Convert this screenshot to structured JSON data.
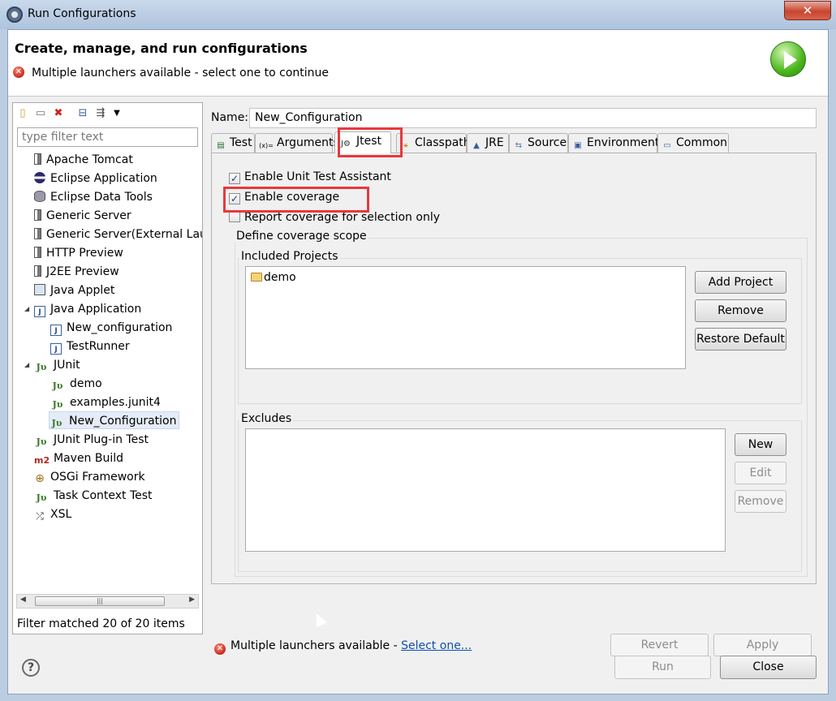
{
  "window": {
    "title": "Run Configurations",
    "close_label": "✕"
  },
  "banner": {
    "title": "Create, manage, and run configurations",
    "message": "Multiple launchers available - select one to continue"
  },
  "left": {
    "toolbar": [
      "new-config-icon",
      "duplicate-icon",
      "delete-icon",
      "collapse-all-icon",
      "filter-icon",
      "view-menu-icon"
    ],
    "filter": {
      "placeholder": "type filter text",
      "value": ""
    },
    "tree": [
      {
        "label": "Apache Tomcat",
        "icon": "server-icon"
      },
      {
        "label": "Eclipse Application",
        "icon": "eclipse-icon"
      },
      {
        "label": "Eclipse Data Tools",
        "icon": "database-icon"
      },
      {
        "label": "Generic Server",
        "icon": "server-icon"
      },
      {
        "label": "Generic Server(External Lau",
        "icon": "server-icon"
      },
      {
        "label": "HTTP Preview",
        "icon": "server-icon"
      },
      {
        "label": "J2EE Preview",
        "icon": "server-icon"
      },
      {
        "label": "Java Applet",
        "icon": "applet-icon"
      },
      {
        "label": "Java Application",
        "icon": "java-app-icon",
        "expanded": true
      },
      {
        "label": "New_configuration",
        "icon": "java-app-icon"
      },
      {
        "label": "TestRunner",
        "icon": "java-app-icon"
      },
      {
        "label": "JUnit",
        "icon": "junit-icon",
        "expanded": true
      },
      {
        "label": "demo",
        "icon": "junit-icon"
      },
      {
        "label": "examples.junit4",
        "icon": "junit-icon"
      },
      {
        "label": "New_Configuration",
        "icon": "junit-icon",
        "selected": true
      },
      {
        "label": "JUnit Plug-in Test",
        "icon": "junit-plugin-icon"
      },
      {
        "label": "Maven Build",
        "icon": "maven-icon"
      },
      {
        "label": "OSGi Framework",
        "icon": "osgi-icon"
      },
      {
        "label": "Task Context Test",
        "icon": "junit-icon"
      },
      {
        "label": "XSL",
        "icon": "xsl-icon"
      }
    ],
    "icon_glyphs": {
      "ju": "Jυ",
      "m2": "m2",
      "osgi": "⊕",
      "xsl": "⤮",
      "app": "J"
    },
    "filter_status": "Filter matched 20 of 20 items"
  },
  "right": {
    "name_label": "Name:",
    "name_value": "New_Configuration",
    "tabs": [
      "Test",
      "Arguments",
      "Jtest",
      "Classpath",
      "JRE",
      "Source",
      "Environment",
      "Common"
    ],
    "tab_icon_glyphs": [
      "▤",
      "(x)=",
      "J⚙",
      "⚹",
      "▲",
      "⇆",
      "▣",
      "▭"
    ],
    "active_tab": "Jtest",
    "checkboxes": [
      {
        "label": "Enable Unit Test Assistant",
        "checked": true
      },
      {
        "label": "Enable coverage",
        "checked": true
      },
      {
        "label": "Report coverage for selection only",
        "checked": false
      }
    ],
    "coverage_scope": {
      "title": "Define coverage scope",
      "included_title": "Included Projects",
      "included": [
        "demo"
      ],
      "included_buttons": [
        "Add Project",
        "Remove",
        "Restore Default"
      ],
      "excludes_title": "Excludes",
      "excludes": [],
      "excludes_buttons": [
        "New",
        "Edit",
        "Remove"
      ]
    },
    "status_text": "Multiple launchers available - ",
    "status_link": "Select one...",
    "revert_label": "Revert",
    "apply_label": "Apply"
  },
  "footer": {
    "help_label": "?",
    "run_label": "Run",
    "close_label": "Close"
  },
  "colors": {
    "highlight": "#e8383d",
    "link": "#0e4fae",
    "error": "#c8281a"
  }
}
